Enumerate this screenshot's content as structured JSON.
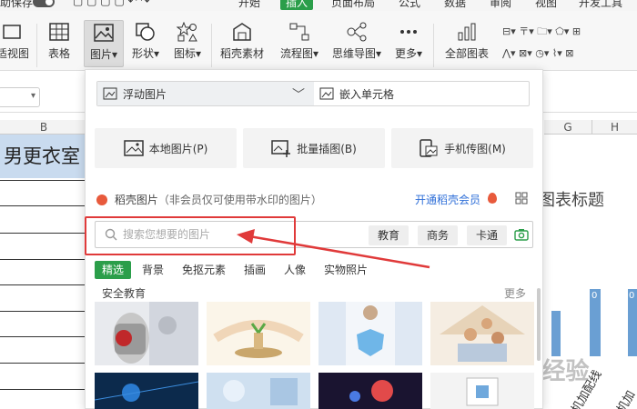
{
  "menubar": {
    "autosave_partial": "助保存",
    "items": [
      "开始",
      "插入",
      "页面布局",
      "公式",
      "数据",
      "审阅",
      "视图",
      "开发工具"
    ],
    "active_index": 1
  },
  "ribbon": {
    "reading_view_partial": "适视图",
    "table": "表格",
    "picture": "图片",
    "shape": "形状",
    "icon": "图标",
    "stock_material": "稻壳素材",
    "flowchart": "流程图",
    "mindmap": "思维导图",
    "more": "更多",
    "all_charts": "全部图表"
  },
  "sheet": {
    "col_b": "B",
    "col_g": "G",
    "col_h": "H",
    "title_cell": "男更衣室",
    "chart_title": "图表标题",
    "axis_labels": [
      "机加配线",
      "机加"
    ],
    "watermark": "Bai 经验"
  },
  "panel": {
    "floating_picture": "浮动图片",
    "embed_cell": "嵌入单元格",
    "local_picture": "本地图片(P)",
    "batch_insert": "批量插图(B)",
    "phone_transfer": "手机传图(M)",
    "stock_label": "稻壳图片",
    "stock_note": "（非会员仅可使用带水印的图片）",
    "vip_link": "开通稻壳会员",
    "search_placeholder": "搜索您想要的图片",
    "chips": [
      "教育",
      "商务",
      "卡通"
    ],
    "categories": [
      "精选",
      "背景",
      "免抠元素",
      "插画",
      "人像",
      "实物照片"
    ],
    "active_category": 0,
    "section_title": "安全教育",
    "more": "更多"
  },
  "colors": {
    "accent_green": "#2b9e4a",
    "link_blue": "#2f6fd8",
    "annotation_red": "#e03a3a",
    "chart_bar": "#6a9fd3"
  }
}
